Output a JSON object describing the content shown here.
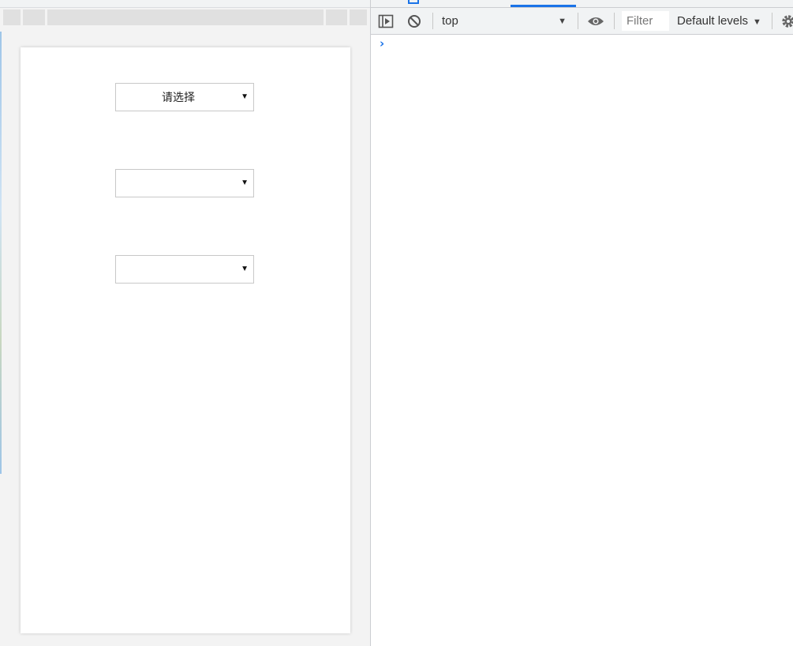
{
  "emulated_page": {
    "selects": [
      {
        "value": "请选择",
        "arrow": "▼"
      },
      {
        "value": "",
        "arrow": "▼"
      },
      {
        "value": "",
        "arrow": "▼"
      }
    ]
  },
  "devtools": {
    "toolbar": {
      "context": "top",
      "context_arrow": "▼",
      "filter_placeholder": "Filter",
      "levels": "Default levels",
      "levels_arrow": "▼"
    },
    "console": {
      "prompt": "›"
    }
  },
  "colors": {
    "accent": "#1a73e8",
    "toolbar_bg": "#f1f3f4",
    "pane_bg": "#f3f3f3",
    "border": "#c8c8c8"
  },
  "icons": [
    "sidebar-toggle-icon",
    "clear-console-icon",
    "eye-icon",
    "gear-icon"
  ]
}
